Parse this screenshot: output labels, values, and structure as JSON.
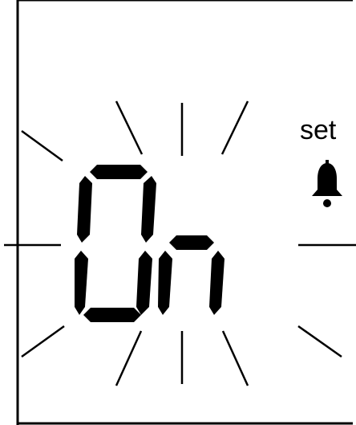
{
  "display": {
    "set_label": "set",
    "readout": "On",
    "alarm_indicator": "bell-icon",
    "state": "on",
    "flashing": true
  },
  "colors": {
    "background": "#ffffff",
    "segment": "#000000",
    "frame": "#000000"
  }
}
